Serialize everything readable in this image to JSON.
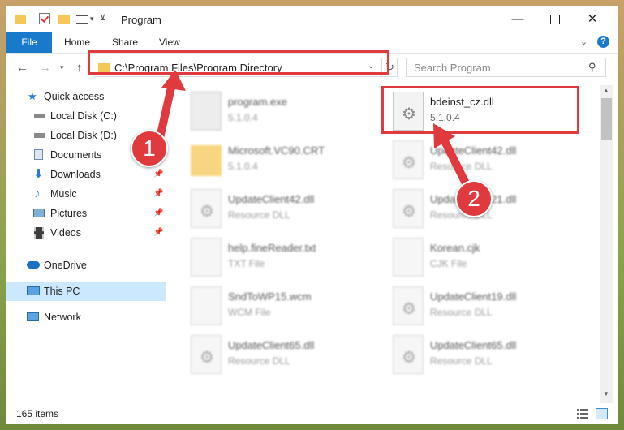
{
  "window": {
    "title": "Program"
  },
  "controls": {
    "minimize": "—",
    "close": "✕"
  },
  "ribbon": {
    "tabs": [
      "File",
      "Home",
      "Share",
      "View"
    ],
    "help": "?"
  },
  "address": {
    "path": "C:\\Program Files\\Program Directory"
  },
  "search": {
    "placeholder": "Search Program"
  },
  "sidebar": {
    "items": [
      {
        "label": "Quick access",
        "icon": "star-icon"
      },
      {
        "label": "Local Disk (C:)",
        "icon": "drive-icon"
      },
      {
        "label": "Local Disk (D:)",
        "icon": "drive-icon"
      },
      {
        "label": "Documents",
        "icon": "documents-icon"
      },
      {
        "label": "Downloads",
        "icon": "download-icon",
        "pinned": true
      },
      {
        "label": "Music",
        "icon": "music-icon",
        "pinned": true
      },
      {
        "label": "Pictures",
        "icon": "pictures-icon",
        "pinned": true
      },
      {
        "label": "Videos",
        "icon": "videos-icon",
        "pinned": true
      },
      {
        "label": "OneDrive",
        "icon": "cloud-icon"
      },
      {
        "label": "This PC",
        "icon": "computer-icon",
        "selected": true
      },
      {
        "label": "Network",
        "icon": "network-icon"
      }
    ]
  },
  "files": [
    {
      "name": "program.exe",
      "detail": "5.1.0.4",
      "kind": "exe"
    },
    {
      "name": "bdeinst_cz.dll",
      "detail": "5.1.0.4",
      "kind": "dll"
    },
    {
      "name": "Microsoft.VC90.CRT",
      "detail": "5.1.0.4",
      "kind": "folder"
    },
    {
      "name": "UpdateClient42.dll",
      "detail": "Resource DLL",
      "kind": "dll"
    },
    {
      "name": "UpdateClient42.dll",
      "detail": "Resource DLL",
      "kind": "dll"
    },
    {
      "name": "UpdateClient21.dll",
      "detail": "Resource DLL",
      "kind": "dll"
    },
    {
      "name": "help.fineReader.txt",
      "detail": "TXT File",
      "kind": "doc"
    },
    {
      "name": "Korean.cjk",
      "detail": "CJK File",
      "kind": "doc"
    },
    {
      "name": "SndToWP15.wcm",
      "detail": "WCM File",
      "kind": "doc"
    },
    {
      "name": "UpdateClient19.dll",
      "detail": "Resource DLL",
      "kind": "dll"
    },
    {
      "name": "UpdateClient65.dll",
      "detail": "Resource DLL",
      "kind": "dll"
    },
    {
      "name": "UpdateClient65.dll",
      "detail": "Resource DLL",
      "kind": "dll"
    }
  ],
  "status": {
    "item_count": "165 items"
  },
  "callouts": {
    "first": "1",
    "second": "2"
  },
  "colors": {
    "accent": "#1979ca",
    "highlight": "#e0393e",
    "selection": "#cce8ff"
  }
}
